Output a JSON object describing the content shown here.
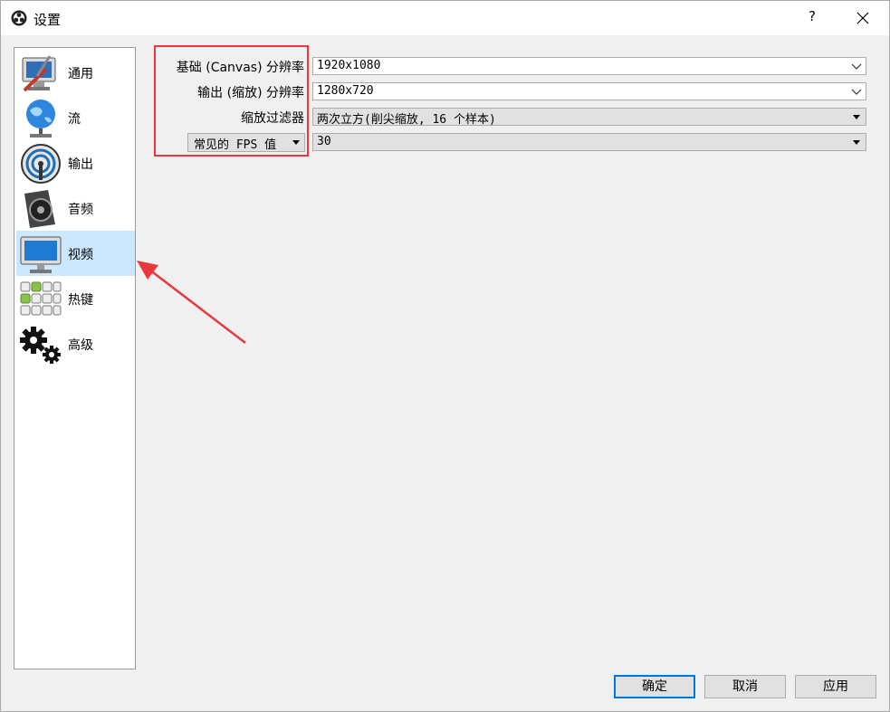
{
  "window": {
    "title": "设置",
    "help_label": "?"
  },
  "sidebar": {
    "items": [
      {
        "label": "通用"
      },
      {
        "label": "流"
      },
      {
        "label": "输出"
      },
      {
        "label": "音频"
      },
      {
        "label": "视频"
      },
      {
        "label": "热键"
      },
      {
        "label": "高级"
      }
    ],
    "selected": "视频"
  },
  "video": {
    "base_label": "基础 (Canvas) 分辨率",
    "base_value": "1920x1080",
    "output_label": "输出 (缩放) 分辨率",
    "output_value": "1280x720",
    "filter_label": "缩放过滤器",
    "filter_value": "两次立方(削尖缩放, 16 个样本)",
    "fps_type": "常见的 FPS 值",
    "fps_value": "30"
  },
  "buttons": {
    "ok": "确定",
    "cancel": "取消",
    "apply": "应用"
  },
  "colors": {
    "highlight": "#e8383d",
    "selected_bg": "#cce8ff",
    "primary_border": "#0078d7"
  }
}
